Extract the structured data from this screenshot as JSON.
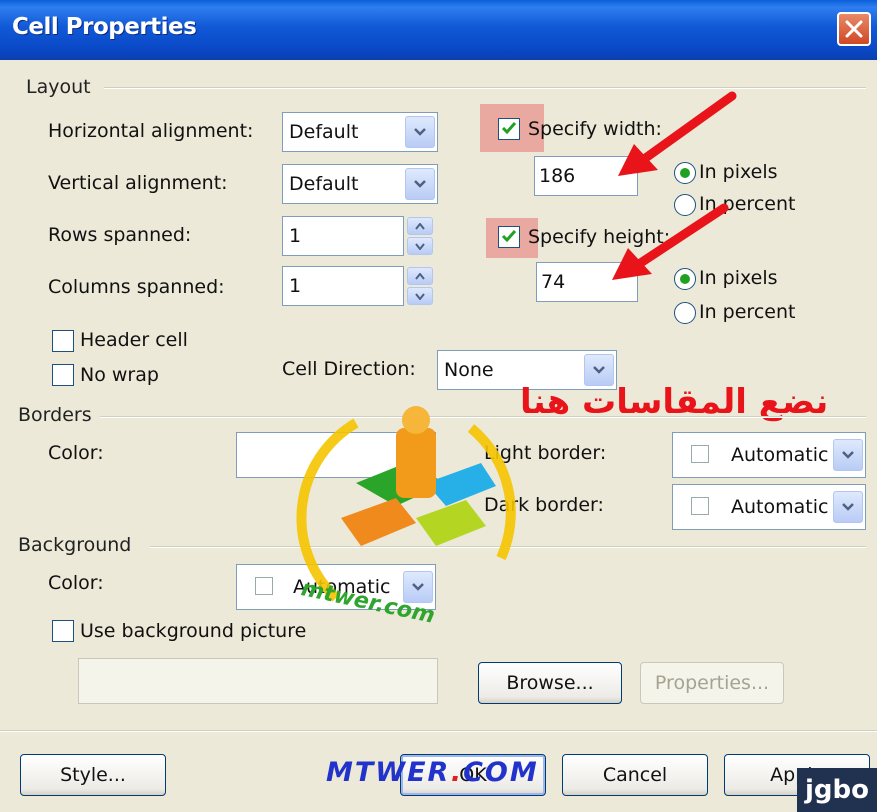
{
  "window": {
    "title": "Cell Properties"
  },
  "layout": {
    "group_label": "Layout",
    "horizontal_alignment": {
      "label": "Horizontal alignment:",
      "value": "Default"
    },
    "vertical_alignment": {
      "label": "Vertical alignment:",
      "value": "Default"
    },
    "rows_spanned": {
      "label": "Rows spanned:",
      "value": "1"
    },
    "columns_spanned": {
      "label": "Columns spanned:",
      "value": "1"
    },
    "header_cell": {
      "label": "Header cell",
      "checked": false
    },
    "no_wrap": {
      "label": "No wrap",
      "checked": false
    },
    "cell_direction": {
      "label": "Cell Direction:",
      "value": "None"
    },
    "specify_width": {
      "label": "Specify width:",
      "checked": true,
      "value": "186",
      "unit_pixels": "In pixels",
      "unit_percent": "In percent",
      "selected_unit": "In pixels"
    },
    "specify_height": {
      "label": "Specify height:",
      "checked": true,
      "value": "74",
      "unit_pixels": "In pixels",
      "unit_percent": "In percent",
      "selected_unit": "In pixels"
    }
  },
  "borders": {
    "group_label": "Borders",
    "color_label": "Color:",
    "light_border": {
      "label": "Light border:",
      "value": "Automatic"
    },
    "dark_border": {
      "label": "Dark border:",
      "value": "Automatic"
    }
  },
  "background": {
    "group_label": "Background",
    "color": {
      "label": "Color:",
      "value": "Automatic"
    },
    "use_picture": {
      "label": "Use background picture",
      "checked": false
    },
    "picture_path": ""
  },
  "buttons": {
    "browse": "Browse...",
    "properties": "Properties...",
    "style": "Style...",
    "ok": "OK",
    "cancel": "Cancel",
    "apply": "Apply"
  },
  "annotation_text": "نضع المقاسات هنا",
  "watermark": {
    "url_blue": "MTWER",
    "url_red": ".",
    "url_tail": "COM",
    "logo_ring_text": "mtwer.com",
    "corner_logo": "jgbo"
  },
  "colors": {
    "title_bar": "#0a49c8",
    "dialog_bg": "#ece9d8",
    "annotation": "#e8141a",
    "arrow": "#e8141a",
    "highlight": "#e9a9a0"
  },
  "icons": [
    "close-icon",
    "chevron-down-icon",
    "spin-up-icon",
    "spin-down-icon",
    "checkmark-icon",
    "red-arrow-icon",
    "watermark-logo-icon"
  ]
}
